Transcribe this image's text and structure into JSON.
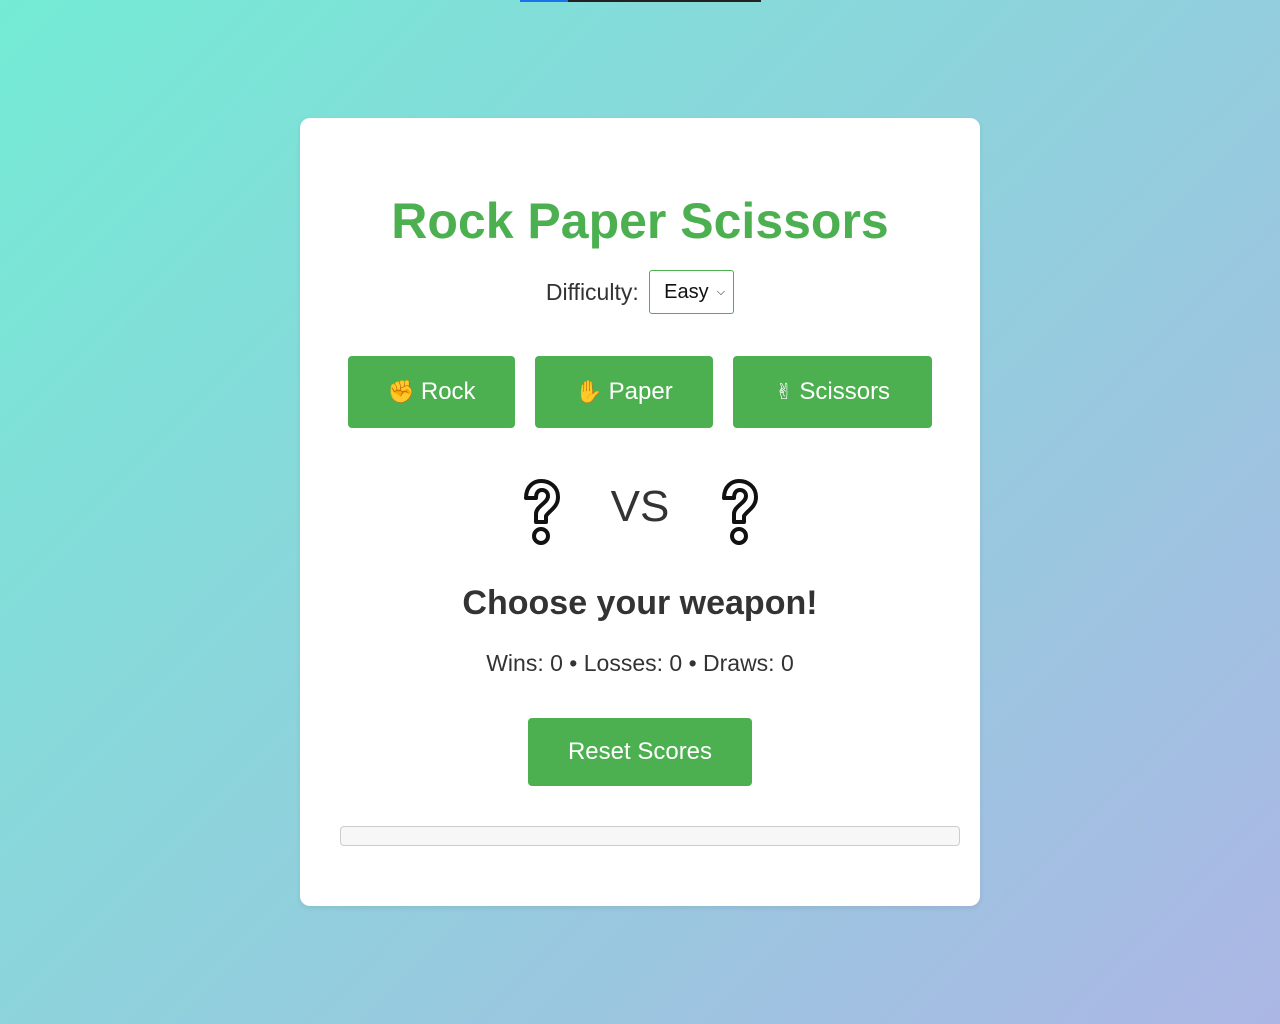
{
  "page_progress": 0.2,
  "title": "Rock Paper Scissors",
  "difficulty": {
    "label": "Difficulty:",
    "selected": "Easy"
  },
  "choices": [
    {
      "emoji": "✊",
      "label": "Rock"
    },
    {
      "emoji": "✋",
      "label": "Paper"
    },
    {
      "emoji": "✌",
      "label": "Scissors"
    }
  ],
  "battle": {
    "player_choice": "?",
    "vs_label": "VS",
    "computer_choice": "?"
  },
  "result_text": "Choose your weapon!",
  "scores_text": "Wins: 0 • Losses: 0 • Draws: 0",
  "reset_label": "Reset Scores",
  "round_progress": 0,
  "colors": {
    "accent": "#4caf50",
    "text": "#333333",
    "bg_start": "#74ebd5",
    "bg_end": "#acb6e5"
  }
}
